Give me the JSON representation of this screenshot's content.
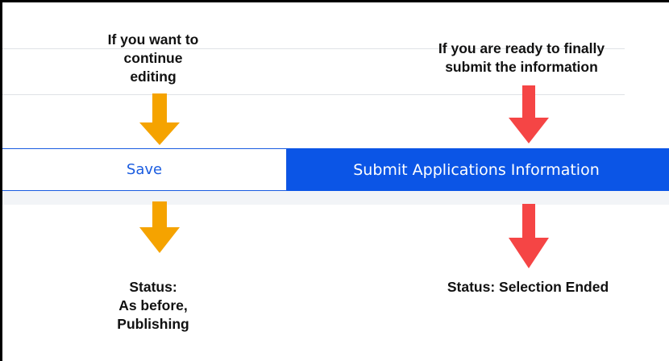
{
  "annotations": {
    "edit_hint": "If you want to\ncontinue\nediting",
    "submit_hint": "If you are ready to finally\nsubmit the information",
    "save_status": "Status:\nAs before,\nPublishing",
    "submit_status": "Status:  Selection Ended"
  },
  "buttons": {
    "save_label": "Save",
    "submit_label": "Submit Applications Information"
  },
  "colors": {
    "save_arrow": "#f5a300",
    "submit_arrow": "#f54545",
    "primary_blue": "#0b55e6",
    "outline_blue": "#1a5ce0"
  }
}
